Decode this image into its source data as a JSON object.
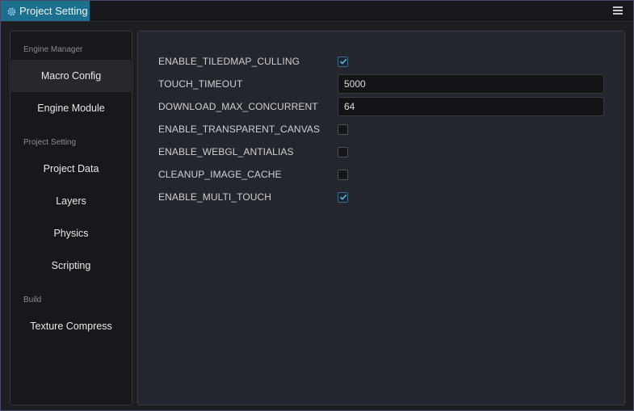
{
  "window": {
    "tab_title": "Project Setting",
    "tab_icon": "gear-icon",
    "menu_icon": "hamburger-menu-icon",
    "accent_color": "#1d6f8e"
  },
  "sidebar": {
    "sections": [
      {
        "label": "Engine Manager",
        "items": [
          "Macro Config",
          "Engine Module"
        ]
      },
      {
        "label": "Project Setting",
        "items": [
          "Project Data",
          "Layers",
          "Physics",
          "Scripting"
        ]
      },
      {
        "label": "Build",
        "items": [
          "Texture Compress"
        ]
      }
    ],
    "active_item": "Macro Config"
  },
  "macros": [
    {
      "label": "ENABLE_TILEDMAP_CULLING",
      "type": "checkbox",
      "checked": true
    },
    {
      "label": "TOUCH_TIMEOUT",
      "type": "input",
      "value": "5000"
    },
    {
      "label": "DOWNLOAD_MAX_CONCURRENT",
      "type": "input",
      "value": "64"
    },
    {
      "label": "ENABLE_TRANSPARENT_CANVAS",
      "type": "checkbox",
      "checked": false
    },
    {
      "label": "ENABLE_WEBGL_ANTIALIAS",
      "type": "checkbox",
      "checked": false
    },
    {
      "label": "CLEANUP_IMAGE_CACHE",
      "type": "checkbox",
      "checked": false
    },
    {
      "label": "ENABLE_MULTI_TOUCH",
      "type": "checkbox",
      "checked": true
    }
  ]
}
